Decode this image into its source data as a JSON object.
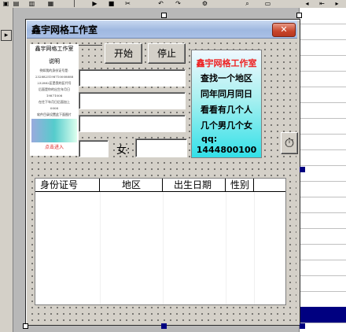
{
  "form": {
    "title": "鑫宇网格工作室",
    "close_label": "✕"
  },
  "buttons": {
    "start": "开始",
    "stop": "停止"
  },
  "labels": {
    "female": "女:"
  },
  "picture": {
    "heading": "鑫宇网格工作室",
    "subheading": "说明",
    "lines": [
      "例如我的身份证号是:",
      "2328825198710008888",
      "232882区是我的区代号",
      "后面是你的出生年月日",
      "19871008",
      "在往下年月日后面加上",
      "0008",
      "软件目录设置此下面图片"
    ],
    "footer": "点击进入"
  },
  "info": {
    "lines": [
      "鑫宇网格工作室",
      "查找一个地区",
      "同年同月同日",
      "看看有几个人",
      "几个男几个女",
      "qq:",
      "1444800100"
    ]
  },
  "table": {
    "columns": [
      "身份证号",
      "地区",
      "出生日期",
      "性别"
    ]
  }
}
